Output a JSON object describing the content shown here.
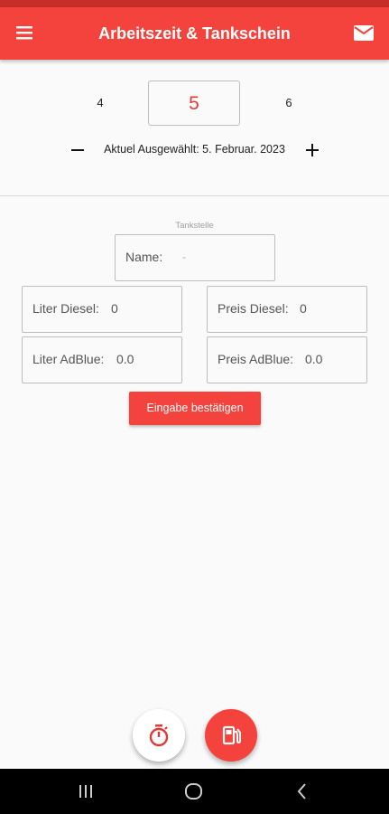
{
  "appbar": {
    "title": "Arbeitszeit & Tankschein",
    "menu_icon": "menu-icon",
    "mail_icon": "mail-icon",
    "color": "#f4433c"
  },
  "day_picker": {
    "prev": "4",
    "current": "5",
    "next": "6",
    "selected_text": "Aktuel Ausgewählt: 5. Februar. 2023"
  },
  "form": {
    "section_label": "Tankstelle",
    "name_label": "Name:",
    "name_value": "-",
    "liter_diesel_label": "Liter Diesel:",
    "liter_diesel_value": "0",
    "preis_diesel_label": "Preis Diesel:",
    "preis_diesel_value": "0",
    "liter_adblue_label": "Liter AdBlue:",
    "liter_adblue_value": "0.0",
    "preis_adblue_label": "Preis AdBlue:",
    "preis_adblue_value": "0.0",
    "confirm_label": "Eingabe bestätigen"
  },
  "fabs": {
    "timer_icon": "stopwatch-icon",
    "fuel_icon": "fuel-pump-icon"
  },
  "navbar": {
    "recents_icon": "recents-icon",
    "home_icon": "home-icon",
    "back_icon": "back-icon"
  }
}
